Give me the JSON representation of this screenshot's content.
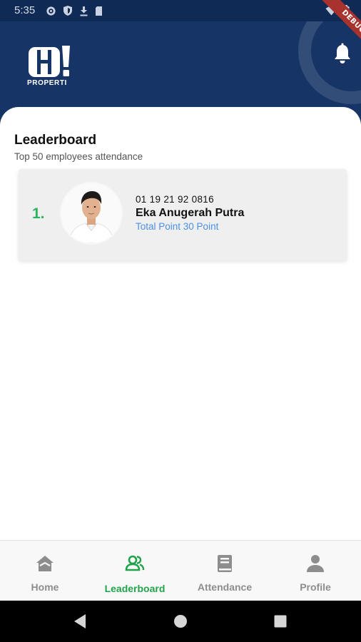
{
  "status_bar": {
    "time": "5:35"
  },
  "debug_banner": "DEBUG",
  "header": {
    "logo_text": "PROPERTI"
  },
  "page": {
    "title": "Leaderboard",
    "subtitle": "Top 50 employees attendance"
  },
  "leaderboard": [
    {
      "rank": "1.",
      "employee_id": "01 19 21 92 0816",
      "name": "Eka Anugerah Putra",
      "points": "Total Point 30 Point"
    }
  ],
  "bottom_nav": {
    "items": [
      {
        "label": "Home",
        "icon": "home-icon",
        "active": false
      },
      {
        "label": "Leaderboard",
        "icon": "people-icon",
        "active": true
      },
      {
        "label": "Attendance",
        "icon": "book-icon",
        "active": false
      },
      {
        "label": "Profile",
        "icon": "person-icon",
        "active": false
      }
    ]
  },
  "colors": {
    "header_bg": "#163566",
    "accent_green": "#2db55d",
    "points_blue": "#4a90e2",
    "nav_inactive": "#8d8d8d"
  }
}
